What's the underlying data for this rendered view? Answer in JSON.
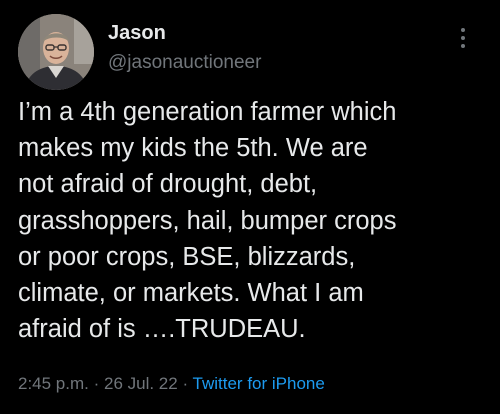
{
  "author": {
    "display_name": "Jason",
    "handle": "@jasonauctioneer"
  },
  "tweet": {
    "lines": [
      "I’m a 4th generation farmer which",
      "makes my kids the 5th. We are",
      "not afraid of drought, debt,",
      "grasshoppers, hail, bumper crops",
      "or poor crops, BSE, blizzards,",
      "climate, or markets. What I am",
      "afraid of is ….TRUDEAU."
    ]
  },
  "meta": {
    "time": "2:45 p.m.",
    "separator_1": " · ",
    "date": "26 Jul. 22",
    "separator_2": " · ",
    "source": "Twitter for iPhone"
  },
  "icons": {
    "more": "more-vertical-icon"
  },
  "colors": {
    "background": "#000000",
    "primary_text": "#e7e9ea",
    "secondary_text": "#71767b",
    "link": "#1d9bf0"
  }
}
